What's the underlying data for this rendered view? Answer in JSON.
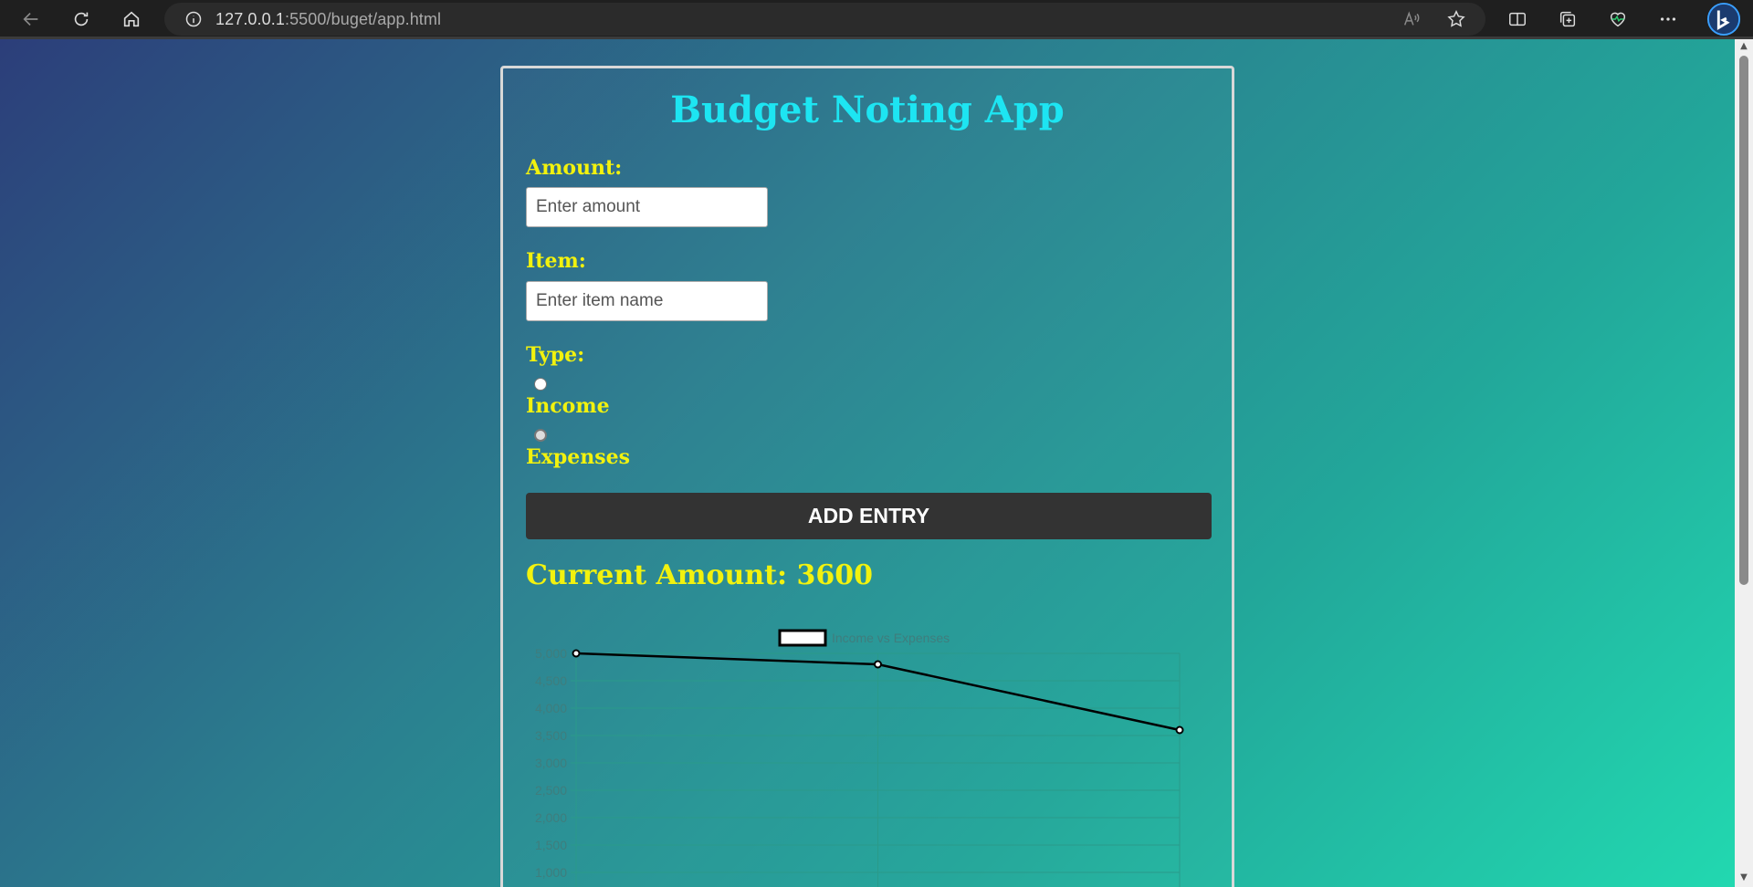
{
  "browser": {
    "url_host": "127.0.0.1",
    "url_path": ":5500/buget/app.html"
  },
  "app": {
    "title": "Budget Noting App",
    "amount_label": "Amount:",
    "amount_placeholder": "Enter amount",
    "item_label": "Item:",
    "item_placeholder": "Enter item name",
    "type_label": "Type:",
    "income_label": "Income",
    "expenses_label": "Expenses",
    "add_button_label": "ADD ENTRY",
    "current_amount_text": "Current Amount: 3600"
  },
  "chart_data": {
    "type": "line",
    "legend": "Income vs Expenses",
    "y_ticks": [
      "5,000",
      "4,500",
      "4,000",
      "3,500",
      "3,000",
      "2,500",
      "2,000",
      "1,500",
      "1,000"
    ],
    "ylim": [
      1000,
      5000
    ],
    "series": [
      {
        "name": "Income vs Expenses",
        "values": [
          5000,
          4800,
          3600
        ]
      }
    ],
    "grid": true,
    "colors": {
      "line": "#000000",
      "grid": "#2a9a8a",
      "tick": "#3f7d7d"
    }
  }
}
